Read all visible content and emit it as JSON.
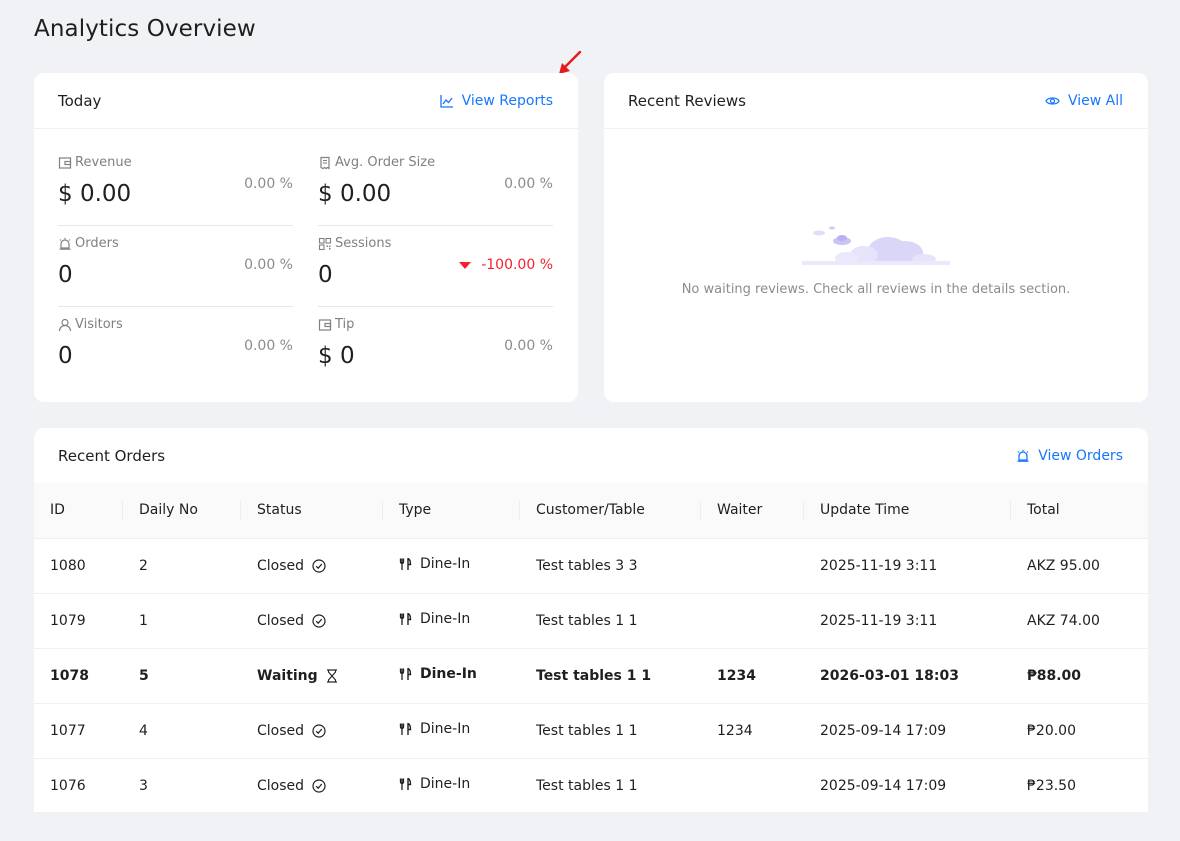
{
  "page": {
    "title": "Analytics Overview"
  },
  "today": {
    "title": "Today",
    "link_label": "View Reports",
    "stats": [
      {
        "label": "Revenue",
        "icon": "wallet-icon",
        "value": "$ 0.00",
        "change": "0.00 %",
        "trend": "flat"
      },
      {
        "label": "Avg. Order Size",
        "icon": "receipt-icon",
        "value": "$ 0.00",
        "change": "0.00 %",
        "trend": "flat"
      },
      {
        "label": "Orders",
        "icon": "bell-icon",
        "value": "0",
        "change": "0.00 %",
        "trend": "flat"
      },
      {
        "label": "Sessions",
        "icon": "qrcode-icon",
        "value": "0",
        "change": "-100.00 %",
        "trend": "down"
      },
      {
        "label": "Visitors",
        "icon": "user-icon",
        "value": "0",
        "change": "0.00 %",
        "trend": "flat"
      },
      {
        "label": "Tip",
        "icon": "wallet-icon",
        "value": "$ 0",
        "change": "0.00 %",
        "trend": "flat"
      }
    ]
  },
  "reviews": {
    "title": "Recent Reviews",
    "link_label": "View All",
    "empty_text": "No waiting reviews. Check all reviews in the details section."
  },
  "orders": {
    "title": "Recent Orders",
    "link_label": "View Orders",
    "columns": [
      "ID",
      "Daily No",
      "Status",
      "Type",
      "Customer/Table",
      "Waiter",
      "Update Time",
      "Total"
    ],
    "rows": [
      {
        "id": "1080",
        "daily_no": "2",
        "status": "Closed",
        "status_icon": "check-circle-icon",
        "type": "Dine-In",
        "customer": "Test tables 3 3",
        "waiter": "",
        "update_time": "2025-11-19 3:11",
        "total": "AKZ 95.00",
        "bold": false
      },
      {
        "id": "1079",
        "daily_no": "1",
        "status": "Closed",
        "status_icon": "check-circle-icon",
        "type": "Dine-In",
        "customer": "Test tables 1 1",
        "waiter": "",
        "update_time": "2025-11-19 3:11",
        "total": "AKZ 74.00",
        "bold": false
      },
      {
        "id": "1078",
        "daily_no": "5",
        "status": "Waiting",
        "status_icon": "hourglass-icon",
        "type": "Dine-In",
        "customer": "Test tables 1 1",
        "waiter": "1234",
        "update_time": "2026-03-01 18:03",
        "total": "₱88.00",
        "bold": true
      },
      {
        "id": "1077",
        "daily_no": "4",
        "status": "Closed",
        "status_icon": "check-circle-icon",
        "type": "Dine-In",
        "customer": "Test tables 1 1",
        "waiter": "1234",
        "update_time": "2025-09-14 17:09",
        "total": "₱20.00",
        "bold": false
      },
      {
        "id": "1076",
        "daily_no": "3",
        "status": "Closed",
        "status_icon": "check-circle-icon",
        "type": "Dine-In",
        "customer": "Test tables 1 1",
        "waiter": "",
        "update_time": "2025-09-14 17:09",
        "total": "₱23.50",
        "bold": false
      }
    ]
  },
  "colors": {
    "accent": "#1677ff",
    "negative": "#f5222d",
    "annotation_arrow": "#e8181b"
  }
}
